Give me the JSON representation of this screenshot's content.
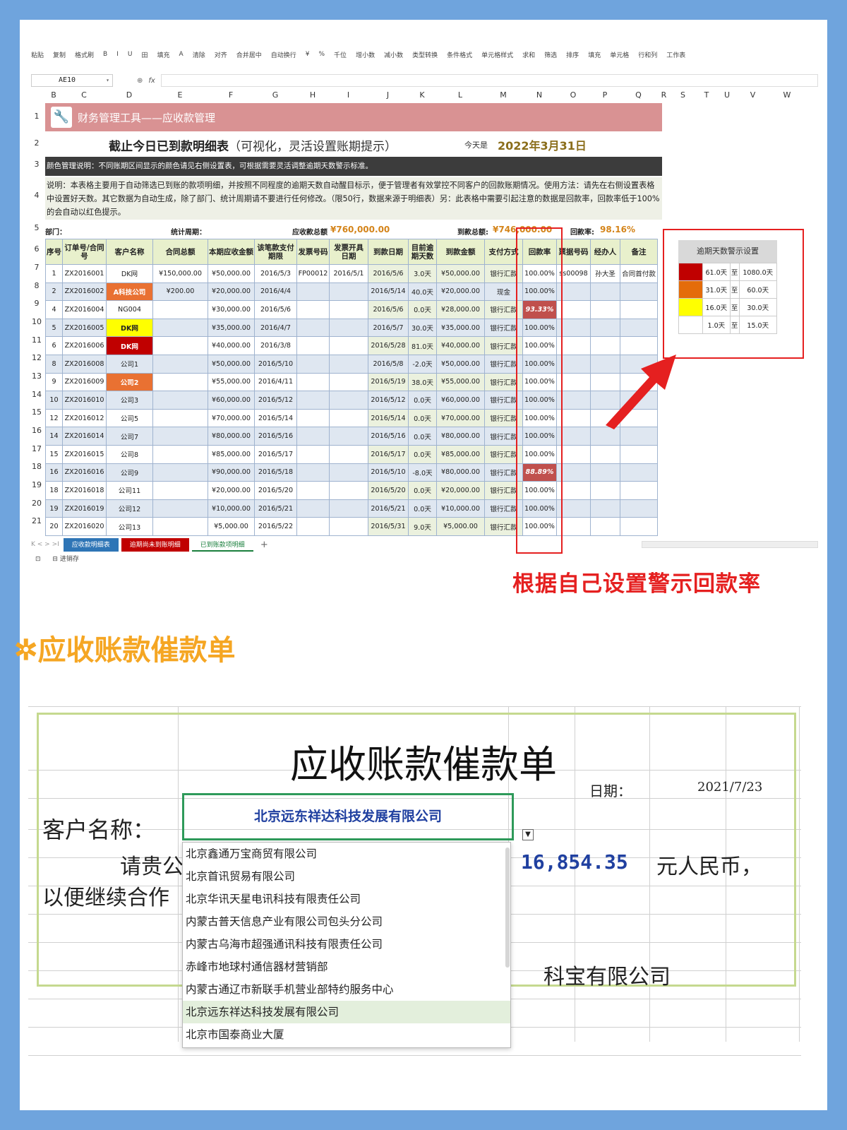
{
  "ribbon": [
    "粘贴",
    "复制",
    "格式刷",
    "B",
    "I",
    "U",
    "田",
    "填充",
    "A",
    "清除",
    "对齐",
    "合并居中",
    "自动换行",
    "¥",
    "%",
    "千位",
    "增小数",
    "减小数",
    "类型转换",
    "条件格式",
    "单元格样式",
    "求和",
    "筛选",
    "排序",
    "填充",
    "单元格",
    "行和列",
    "工作表"
  ],
  "formula_bar": {
    "cell_ref": "AE10",
    "fx": "fx"
  },
  "columns": [
    "B",
    "C",
    "D",
    "E",
    "F",
    "G",
    "H",
    "I",
    "J",
    "K",
    "L",
    "M",
    "N",
    "O",
    "P",
    "Q",
    "R",
    "S",
    "T",
    "U",
    "V",
    "W"
  ],
  "row_numbers": [
    "1",
    "2",
    "3",
    "4",
    "5",
    "6",
    "7",
    "8",
    "9",
    "10",
    "11",
    "12",
    "13",
    "14",
    "15",
    "16",
    "17",
    "18",
    "19",
    "20",
    "21"
  ],
  "banner": {
    "title": "财务管理工具——应收款管理"
  },
  "subtitle": {
    "main": "截止今日已到款明细表",
    "paren": "（可视化，灵活设置账期提示）",
    "today_label": "今天是",
    "today_value": "2022年3月31日"
  },
  "color_note": "颜色管理说明：不同账期区间显示的颜色请见右侧设置表，可根据需要灵活调整逾期天数警示标准。",
  "description": "说明：本表格主要用于自动筛选已到账的款项明细，并按照不同程度的逾期天数自动醒目标示，便于管理者有效掌控不同客户的回款账期情况。使用方法：请先在右侧设置表格中设置好天数。其它数据为自动生成，除了部门、统计周期请不要进行任何修改。（限50行，数据来源于明细表）另：此表格中需要引起注意的数据是回款率，回款率低于100%的会自动以红色提示。",
  "summary": {
    "dept": "部门：",
    "period": "统计周期：",
    "receivable_label": "应收款总额",
    "receivable": "¥760,000.00",
    "received_label": "到款总额:",
    "received": "¥746,000.00",
    "rate_label": "回款率:",
    "rate": "98.16%"
  },
  "table": {
    "headers": [
      "序号",
      "订单号/合同号",
      "客户名称",
      "合同总额",
      "本期应收金额",
      "该笔款支付期限",
      "发票号码",
      "发票开具日期",
      "到款日期",
      "目前逾期天数",
      "到款金额",
      "支付方式",
      "回款率",
      "票据号码",
      "经办人",
      "备注"
    ],
    "rows": [
      [
        "1",
        "ZX2016001",
        "DK网",
        "¥150,000.00",
        "¥50,000.00",
        "2016/5/3",
        "FP00012",
        "2016/5/1",
        "2016/5/6",
        "3.0天",
        "¥50,000.00",
        "银行汇款",
        "100.00%",
        "ss00098",
        "孙大圣",
        "合同首付款"
      ],
      [
        "2",
        "ZX2016002",
        "A科技公司",
        "¥200.00",
        "¥20,000.00",
        "2016/4/4",
        "",
        "",
        "2016/5/14",
        "40.0天",
        "¥20,000.00",
        "现金",
        "100.00%",
        "",
        "",
        ""
      ],
      [
        "4",
        "ZX2016004",
        "NG004",
        "",
        "¥30,000.00",
        "2016/5/6",
        "",
        "",
        "2016/5/6",
        "0.0天",
        "¥28,000.00",
        "银行汇款",
        "93.33%",
        "",
        "",
        ""
      ],
      [
        "5",
        "ZX2016005",
        "DK网",
        "",
        "¥35,000.00",
        "2016/4/7",
        "",
        "",
        "2016/5/7",
        "30.0天",
        "¥35,000.00",
        "银行汇款",
        "100.00%",
        "",
        "",
        ""
      ],
      [
        "6",
        "ZX2016006",
        "DK网",
        "",
        "¥40,000.00",
        "2016/3/8",
        "",
        "",
        "2016/5/28",
        "81.0天",
        "¥40,000.00",
        "银行汇款",
        "100.00%",
        "",
        "",
        ""
      ],
      [
        "8",
        "ZX2016008",
        "公司1",
        "",
        "¥50,000.00",
        "2016/5/10",
        "",
        "",
        "2016/5/8",
        "-2.0天",
        "¥50,000.00",
        "银行汇款",
        "100.00%",
        "",
        "",
        ""
      ],
      [
        "9",
        "ZX2016009",
        "公司2",
        "",
        "¥55,000.00",
        "2016/4/11",
        "",
        "",
        "2016/5/19",
        "38.0天",
        "¥55,000.00",
        "银行汇款",
        "100.00%",
        "",
        "",
        ""
      ],
      [
        "10",
        "ZX2016010",
        "公司3",
        "",
        "¥60,000.00",
        "2016/5/12",
        "",
        "",
        "2016/5/12",
        "0.0天",
        "¥60,000.00",
        "银行汇款",
        "100.00%",
        "",
        "",
        ""
      ],
      [
        "12",
        "ZX2016012",
        "公司5",
        "",
        "¥70,000.00",
        "2016/5/14",
        "",
        "",
        "2016/5/14",
        "0.0天",
        "¥70,000.00",
        "银行汇款",
        "100.00%",
        "",
        "",
        ""
      ],
      [
        "14",
        "ZX2016014",
        "公司7",
        "",
        "¥80,000.00",
        "2016/5/16",
        "",
        "",
        "2016/5/16",
        "0.0天",
        "¥80,000.00",
        "银行汇款",
        "100.00%",
        "",
        "",
        ""
      ],
      [
        "15",
        "ZX2016015",
        "公司8",
        "",
        "¥85,000.00",
        "2016/5/17",
        "",
        "",
        "2016/5/17",
        "0.0天",
        "¥85,000.00",
        "银行汇款",
        "100.00%",
        "",
        "",
        ""
      ],
      [
        "16",
        "ZX2016016",
        "公司9",
        "",
        "¥90,000.00",
        "2016/5/18",
        "",
        "",
        "2016/5/10",
        "-8.0天",
        "¥80,000.00",
        "银行汇款",
        "88.89%",
        "",
        "",
        ""
      ],
      [
        "18",
        "ZX2016018",
        "公司11",
        "",
        "¥20,000.00",
        "2016/5/20",
        "",
        "",
        "2016/5/20",
        "0.0天",
        "¥20,000.00",
        "银行汇款",
        "100.00%",
        "",
        "",
        ""
      ],
      [
        "19",
        "ZX2016019",
        "公司12",
        "",
        "¥10,000.00",
        "2016/5/21",
        "",
        "",
        "2016/5/21",
        "0.0天",
        "¥10,000.00",
        "银行汇款",
        "100.00%",
        "",
        "",
        ""
      ],
      [
        "20",
        "ZX2016020",
        "公司13",
        "",
        "¥5,000.00",
        "2016/5/22",
        "",
        "",
        "2016/5/31",
        "9.0天",
        "¥5,000.00",
        "银行汇款",
        "100.00%",
        "",
        "",
        ""
      ]
    ]
  },
  "warn_panel": {
    "title": "逾期天数警示设置",
    "rows": [
      {
        "color": "#c00000",
        "from": "61.0天",
        "to_label": "至",
        "to": "1080.0天"
      },
      {
        "color": "#e46c0a",
        "from": "31.0天",
        "to_label": "至",
        "to": "60.0天"
      },
      {
        "color": "#ffff00",
        "from": "16.0天",
        "to_label": "至",
        "to": "30.0天"
      },
      {
        "color": "#ffffff",
        "from": "1.0天",
        "to_label": "至",
        "to": "15.0天"
      }
    ]
  },
  "sheet_tabs": [
    {
      "label": "应收款明细表",
      "color": "#2e75b6"
    },
    {
      "label": "逾期尚未到账明细",
      "color": "#c00000"
    },
    {
      "label": "已到账款项明细",
      "color": "#ffffff"
    }
  ],
  "status": {
    "label": "进销存"
  },
  "annotation": "根据自己设置警示回款率",
  "section_title": "✲应收账款催款单",
  "notice": {
    "title": "应收账款催款单",
    "date_label": "日期：",
    "date_value": "2021/7/23",
    "customer_label": "客户名称：",
    "customer_value": "北京远东祥达科技发展有限公司",
    "para1": "请贵公",
    "amount": "16,854.35",
    "yuan": "元人民币，",
    "para2": "以便继续合作",
    "company": "科宝有限公司",
    "options": [
      "北京鑫通万宝商贸有限公司",
      "北京首讯贸易有限公司",
      "北京华讯天星电讯科技有限责任公司",
      "内蒙古普天信息产业有限公司包头分公司",
      "内蒙古乌海市超强通讯科技有限责任公司",
      "赤峰市地球村通信器材营销部",
      "内蒙古通辽市新联手机营业部特约服务中心",
      "北京远东祥达科技发展有限公司",
      "北京市国泰商业大厦"
    ],
    "selected_index": 7
  }
}
